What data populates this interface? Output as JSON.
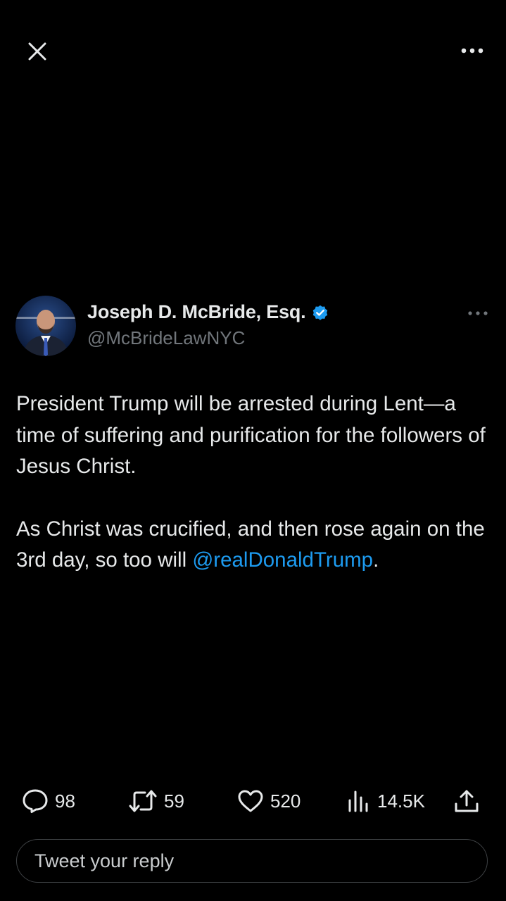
{
  "colors": {
    "background": "#000000",
    "text_primary": "#e7e9ea",
    "text_secondary": "#71767b",
    "accent": "#1d9bf0",
    "verified": "#1d9bf0"
  },
  "top_bar": {
    "close_icon": "close-icon",
    "more_icon": "more-horizontal-icon"
  },
  "author": {
    "name": "Joseph D. McBride, Esq.",
    "handle": "@McBrideLawNYC",
    "verified": true,
    "avatar_icon": "avatar"
  },
  "tweet": {
    "paragraph1": "President Trump will be arrested during Lent—a time of suffering and purification for the followers of Jesus Christ.",
    "paragraph2_text": "As Christ was crucified, and then rose again on the 3rd day, so too will ",
    "mention": "@realDonaldTrump",
    "paragraph2_end": "."
  },
  "actions": {
    "replies": "98",
    "retweets": "59",
    "likes": "520",
    "views": "14.5K",
    "icons": [
      "reply-icon",
      "retweet-icon",
      "like-icon",
      "views-icon",
      "share-icon"
    ]
  },
  "reply": {
    "placeholder": "Tweet your reply"
  }
}
